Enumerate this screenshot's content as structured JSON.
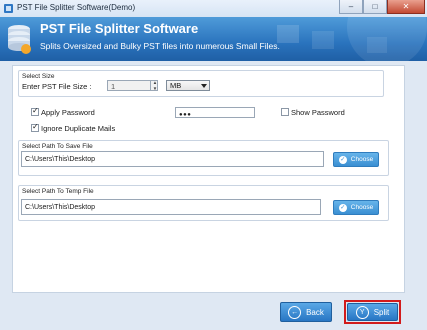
{
  "window": {
    "title": "PST File Splitter Software(Demo)",
    "minimize": "–",
    "maximize": "□",
    "close": "✕"
  },
  "banner": {
    "heading": "PST File Splitter Software",
    "subheading": "Splits Oversized and Bulky PST files into numerous Small Files."
  },
  "size_group": {
    "legend": "Select Size",
    "label": "Enter PST File Size :",
    "value": "1",
    "unit": "MB"
  },
  "options": {
    "apply_password": "Apply Password",
    "apply_password_checked": true,
    "password_mask": "●●●",
    "show_password": "Show Password",
    "show_password_checked": false,
    "ignore_duplicates": "Ignore Duplicate Mails",
    "ignore_duplicates_checked": true
  },
  "save_group": {
    "legend": "Select Path To Save File",
    "path": "C:\\Users\\This\\Desktop",
    "button": "Choose"
  },
  "temp_group": {
    "legend": "Select Path To Temp File",
    "path": "C:\\Users\\This\\Desktop",
    "button": "Choose"
  },
  "footer": {
    "back": "Back",
    "split": "Split"
  },
  "colors": {
    "accent": "#2a73bd",
    "highlight": "#d21b1b"
  }
}
